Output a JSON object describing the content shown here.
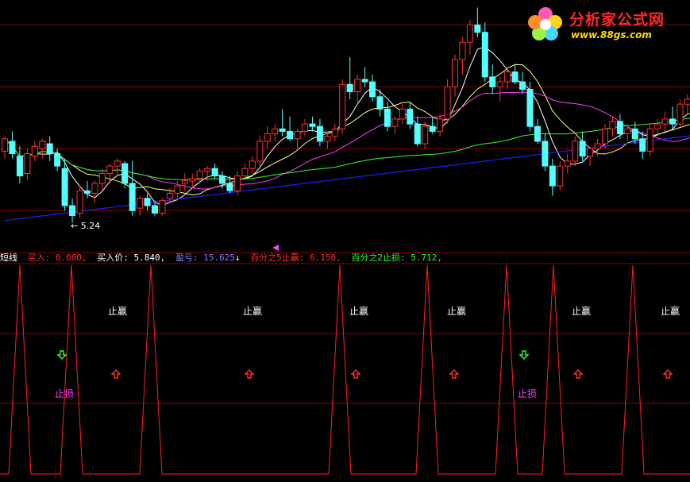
{
  "watermark": {
    "title": "分析家公式网",
    "url": "www.88gs.com"
  },
  "indicator": {
    "name": "短线",
    "fields": [
      {
        "label": "买入:",
        "value": "0.000,",
        "color": "#ff3030"
      },
      {
        "label": "买入价:",
        "value": "5.840,",
        "color": "#ffffff"
      },
      {
        "label": "盈亏:",
        "value": "15.625",
        "color": "#8080ff"
      },
      {
        "label": "百分之5止赢:",
        "value": "6.150,",
        "color": "#ff3030"
      },
      {
        "label": "百分之2止损:",
        "value": "5.712,",
        "color": "#30ff30"
      }
    ],
    "arrow_glyph": "↓"
  },
  "colors": {
    "up": "#ff3232",
    "down": "#54ffff",
    "ma5": "#ffffff",
    "ma10": "#ffff80",
    "ma20": "#ff40ff",
    "ma60": "#30ff30",
    "ma120": "#2020ff",
    "grid": "#8b0000",
    "osc": "#ff2020"
  },
  "chart_data": {
    "type": "candlestick",
    "ylim": [
      5.0,
      6.95
    ],
    "min_annotation": "← 5.24",
    "candles": [
      [
        5.78,
        5.9,
        5.72,
        5.88
      ],
      [
        5.86,
        5.94,
        5.72,
        5.76
      ],
      [
        5.74,
        5.82,
        5.52,
        5.58
      ],
      [
        5.6,
        5.8,
        5.55,
        5.76
      ],
      [
        5.74,
        5.86,
        5.7,
        5.82
      ],
      [
        5.8,
        5.88,
        5.72,
        5.86
      ],
      [
        5.84,
        5.9,
        5.7,
        5.76
      ],
      [
        5.76,
        5.8,
        5.62,
        5.66
      ],
      [
        5.64,
        5.72,
        5.3,
        5.34
      ],
      [
        5.34,
        5.4,
        5.2,
        5.26
      ],
      [
        5.28,
        5.5,
        5.24,
        5.46
      ],
      [
        5.46,
        5.54,
        5.4,
        5.44
      ],
      [
        5.44,
        5.54,
        5.36,
        5.52
      ],
      [
        5.52,
        5.64,
        5.46,
        5.6
      ],
      [
        5.6,
        5.68,
        5.52,
        5.66
      ],
      [
        5.66,
        5.72,
        5.58,
        5.7
      ],
      [
        5.68,
        5.7,
        5.48,
        5.52
      ],
      [
        5.52,
        5.7,
        5.26,
        5.3
      ],
      [
        5.32,
        5.42,
        5.26,
        5.4
      ],
      [
        5.4,
        5.44,
        5.3,
        5.34
      ],
      [
        5.34,
        5.38,
        5.26,
        5.28
      ],
      [
        5.28,
        5.4,
        5.26,
        5.38
      ],
      [
        5.4,
        5.48,
        5.36,
        5.44
      ],
      [
        5.44,
        5.54,
        5.4,
        5.5
      ],
      [
        5.52,
        5.6,
        5.46,
        5.54
      ],
      [
        5.54,
        5.6,
        5.48,
        5.56
      ],
      [
        5.56,
        5.64,
        5.52,
        5.62
      ],
      [
        5.62,
        5.66,
        5.54,
        5.64
      ],
      [
        5.64,
        5.68,
        5.56,
        5.58
      ],
      [
        5.58,
        5.62,
        5.48,
        5.52
      ],
      [
        5.52,
        5.58,
        5.44,
        5.46
      ],
      [
        5.46,
        5.62,
        5.42,
        5.58
      ],
      [
        5.58,
        5.68,
        5.56,
        5.64
      ],
      [
        5.64,
        5.74,
        5.6,
        5.7
      ],
      [
        5.7,
        5.9,
        5.66,
        5.86
      ],
      [
        5.86,
        5.98,
        5.8,
        5.92
      ],
      [
        5.92,
        6.0,
        5.86,
        5.96
      ],
      [
        5.96,
        6.12,
        5.9,
        5.94
      ],
      [
        5.94,
        6.06,
        5.86,
        5.88
      ],
      [
        5.88,
        5.96,
        5.8,
        5.94
      ],
      [
        5.94,
        6.04,
        5.9,
        6.0
      ],
      [
        6.0,
        6.06,
        5.94,
        5.98
      ],
      [
        5.98,
        6.04,
        5.82,
        5.86
      ],
      [
        5.86,
        5.94,
        5.8,
        5.9
      ],
      [
        5.9,
        6.0,
        5.86,
        5.96
      ],
      [
        5.96,
        6.36,
        5.92,
        6.32
      ],
      [
        6.32,
        6.54,
        6.2,
        6.26
      ],
      [
        6.26,
        6.4,
        6.16,
        6.36
      ],
      [
        6.36,
        6.46,
        6.3,
        6.34
      ],
      [
        6.34,
        6.4,
        6.18,
        6.22
      ],
      [
        6.22,
        6.28,
        6.06,
        6.12
      ],
      [
        6.12,
        6.18,
        5.94,
        5.98
      ],
      [
        5.98,
        6.06,
        5.92,
        6.04
      ],
      [
        6.04,
        6.16,
        6.0,
        6.12
      ],
      [
        6.12,
        6.18,
        5.96,
        6.0
      ],
      [
        6.0,
        6.06,
        5.82,
        5.84
      ],
      [
        5.84,
        6.02,
        5.8,
        5.98
      ],
      [
        5.98,
        6.06,
        5.92,
        5.94
      ],
      [
        5.94,
        6.08,
        5.9,
        6.04
      ],
      [
        6.04,
        6.36,
        6.0,
        6.3
      ],
      [
        6.3,
        6.56,
        6.22,
        6.52
      ],
      [
        6.52,
        6.7,
        6.4,
        6.66
      ],
      [
        6.66,
        6.84,
        6.56,
        6.8
      ],
      [
        6.8,
        6.94,
        6.7,
        6.74
      ],
      [
        6.74,
        6.82,
        6.34,
        6.38
      ],
      [
        6.38,
        6.48,
        6.24,
        6.3
      ],
      [
        6.3,
        6.38,
        6.18,
        6.34
      ],
      [
        6.34,
        6.46,
        6.28,
        6.42
      ],
      [
        6.42,
        6.48,
        6.32,
        6.34
      ],
      [
        6.34,
        6.42,
        6.24,
        6.28
      ],
      [
        6.28,
        6.34,
        5.94,
        5.98
      ],
      [
        5.98,
        6.04,
        5.84,
        5.86
      ],
      [
        5.86,
        5.92,
        5.62,
        5.66
      ],
      [
        5.66,
        5.72,
        5.42,
        5.5
      ],
      [
        5.5,
        5.7,
        5.46,
        5.66
      ],
      [
        5.66,
        5.76,
        5.6,
        5.7
      ],
      [
        5.7,
        5.9,
        5.66,
        5.86
      ],
      [
        5.86,
        5.94,
        5.7,
        5.74
      ],
      [
        5.74,
        5.82,
        5.66,
        5.8
      ],
      [
        5.8,
        5.88,
        5.74,
        5.84
      ],
      [
        5.84,
        6.0,
        5.8,
        5.96
      ],
      [
        5.96,
        6.06,
        5.9,
        6.02
      ],
      [
        6.02,
        6.08,
        5.88,
        5.92
      ],
      [
        5.92,
        6.0,
        5.86,
        5.96
      ],
      [
        5.96,
        6.02,
        5.84,
        5.88
      ],
      [
        5.88,
        5.94,
        5.72,
        5.78
      ],
      [
        5.78,
        6.0,
        5.74,
        5.96
      ],
      [
        5.96,
        6.04,
        5.9,
        6.0
      ],
      [
        6.0,
        6.1,
        5.94,
        6.04
      ],
      [
        6.04,
        6.14,
        5.96,
        6.0
      ],
      [
        6.0,
        6.2,
        5.98,
        6.16
      ],
      [
        6.16,
        6.24,
        6.08,
        6.2
      ],
      [
        6.2,
        6.3,
        6.02,
        6.06
      ]
    ],
    "overlay_labels": {
      "stop_profit": "止赢",
      "stop_loss": "止损"
    },
    "osc_peaks": [
      25,
      90,
      190,
      428,
      538,
      638,
      697,
      797
    ],
    "stop_profit_x": [
      146,
      316,
      450,
      573,
      730,
      842
    ],
    "up_arrow_x": [
      146,
      314,
      448,
      572,
      728,
      841
    ],
    "down_arrow_x": [
      78,
      660
    ],
    "stop_loss_x": [
      81,
      664
    ]
  }
}
